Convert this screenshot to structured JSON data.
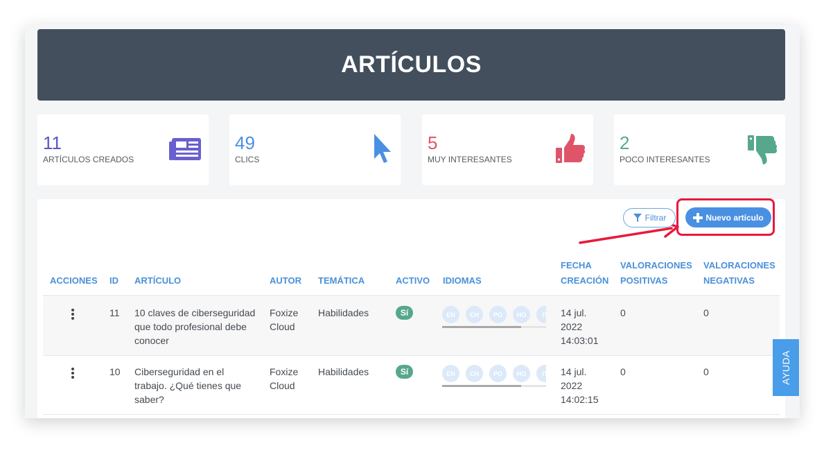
{
  "header": {
    "title": "ARTÍCULOS"
  },
  "stats": [
    {
      "value": "11",
      "label": "ARTÍCULOS CREADOS",
      "icon": "newspaper-icon",
      "color": "#5a55c4"
    },
    {
      "value": "49",
      "label": "CLICS",
      "icon": "cursor-icon",
      "color": "#4a90e2"
    },
    {
      "value": "5",
      "label": "MUY INTERESANTES",
      "icon": "thumbs-up-icon",
      "color": "#e0546a"
    },
    {
      "value": "2",
      "label": "POCO INTERESANTES",
      "icon": "thumbs-down-icon",
      "color": "#55a88d"
    }
  ],
  "toolbar": {
    "filter_label": "Filtrar",
    "new_label": "Nuevo artículo"
  },
  "table": {
    "columns": {
      "acciones": "ACCIONES",
      "id": "ID",
      "articulo": "ARTÍCULO",
      "autor": "AUTOR",
      "tematica": "TEMÁTICA",
      "activo": "ACTIVO",
      "idiomas": "IDIOMAS",
      "fecha_l1": "FECHA",
      "fecha_l2": "CREACIÓN",
      "vpos_l1": "VALORACIONES",
      "vpos_l2": "POSITIVAS",
      "vneg_l1": "VALORACIONES",
      "vneg_l2": "NEGATIVAS"
    },
    "rows": [
      {
        "id": "11",
        "title": "10 claves de ciberseguridad que todo profesional debe conocer",
        "author": "Foxize Cloud",
        "topic": "Habilidades",
        "active": "Sí",
        "languages": [
          "EN",
          "CH",
          "PO",
          "HO",
          "IT"
        ],
        "date_l1": "14 jul.",
        "date_l2": "2022",
        "date_l3": "14:03:01",
        "positive": "0",
        "negative": "0"
      },
      {
        "id": "10",
        "title": "Ciberseguridad en el trabajo. ¿Qué tienes que saber?",
        "author": "Foxize Cloud",
        "topic": "Habilidades",
        "active": "Sí",
        "languages": [
          "EN",
          "CH",
          "PO",
          "HO",
          "IT"
        ],
        "date_l1": "14 jul.",
        "date_l2": "2022",
        "date_l3": "14:02:15",
        "positive": "0",
        "negative": "0"
      }
    ]
  },
  "help": {
    "label": "AYUDA"
  }
}
